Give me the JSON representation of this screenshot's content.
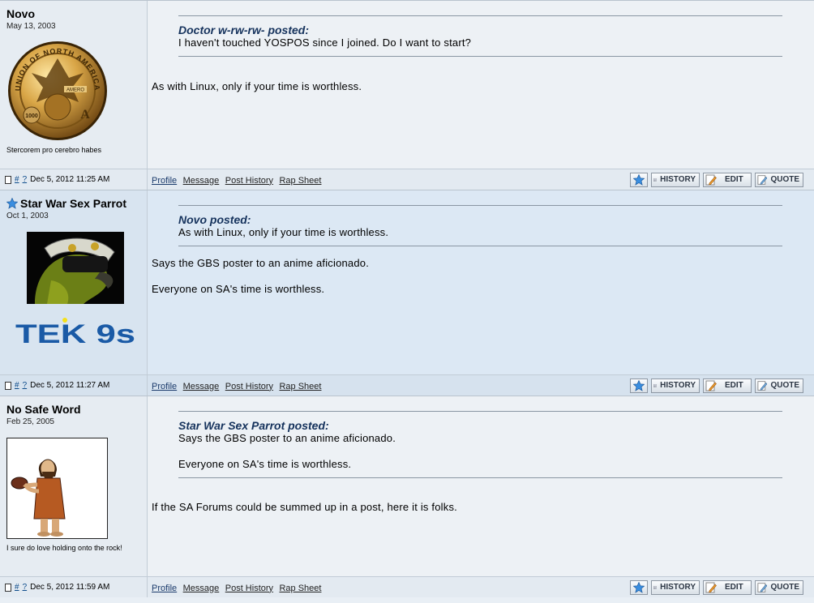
{
  "posts": [
    {
      "author": "Novo",
      "regdate": "May 13, 2003",
      "has_star": false,
      "title_text": "Stercorem pro cerebro habes",
      "quote": {
        "author_line": "Doctor w-rw-rw- posted:",
        "paragraphs": [
          "I haven't touched YOSPOS since I joined. Do I want to start?"
        ]
      },
      "body": [
        "As with Linux, only if your time is worthless."
      ],
      "postdate": "Dec 5, 2012 11:25 AM"
    },
    {
      "author": "Star War Sex Parrot",
      "regdate": "Oct 1, 2003",
      "has_star": true,
      "title_text": "TEK 9s",
      "quote": {
        "author_line": "Novo posted:",
        "paragraphs": [
          "As with Linux, only if your time is worthless."
        ]
      },
      "body": [
        "Says the GBS poster to an anime aficionado.",
        "Everyone on SA's time is worthless."
      ],
      "postdate": "Dec 5, 2012 11:27 AM"
    },
    {
      "author": "No Safe Word",
      "regdate": "Feb 25, 2005",
      "has_star": false,
      "title_text": "I sure do love holding onto the rock!",
      "quote": {
        "author_line": "Star War Sex Parrot posted:",
        "paragraphs": [
          "Says the GBS poster to an anime aficionado.",
          "Everyone on SA's time is worthless."
        ]
      },
      "body": [
        "If the SA Forums could be summed up in a post, here it is folks."
      ],
      "postdate": "Dec 5, 2012 11:59 AM"
    }
  ],
  "postlinks": {
    "hash": "#",
    "question": "?"
  },
  "profile_links": {
    "profile": "Profile",
    "message": "Message",
    "history": "Post History",
    "rapsheet": "Rap Sheet"
  },
  "buttons": {
    "history": "HISTORY",
    "edit": "EDIT",
    "quote": "QUOTE"
  },
  "avatar1": {
    "top_text": "UNION OF NORTH AMERICA",
    "ribbon": "AMERO",
    "amount": "1000"
  },
  "colors": {
    "accent": "#15325c",
    "link": "#1a3a6b",
    "star": "#3a8ee0"
  }
}
